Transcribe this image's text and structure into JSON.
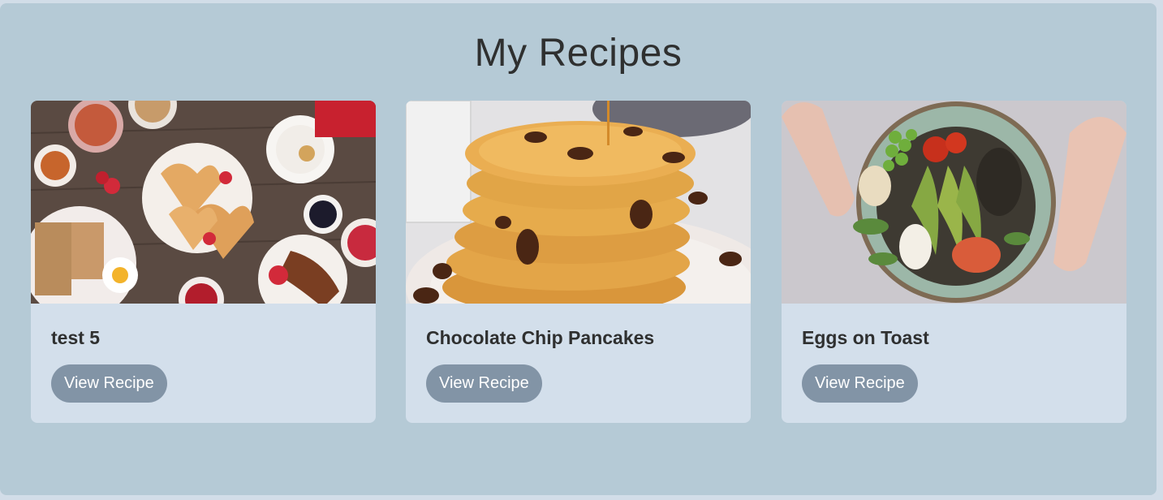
{
  "page": {
    "title": "My Recipes"
  },
  "recipes": [
    {
      "name": "test 5",
      "button_label": "View Recipe",
      "image": "breakfast-spread-photo"
    },
    {
      "name": "Chocolate Chip Pancakes",
      "button_label": "View Recipe",
      "image": "pancake-stack-photo"
    },
    {
      "name": "Eggs on Toast",
      "button_label": "View Recipe",
      "image": "salad-bowl-photo"
    }
  ],
  "colors": {
    "page_background": "#d2dde8",
    "panel_background": "#b5cad6",
    "card_background": "#d3dfeb",
    "button_background": "#8294a6",
    "button_text": "#ffffff",
    "title_text": "#2f3030"
  }
}
